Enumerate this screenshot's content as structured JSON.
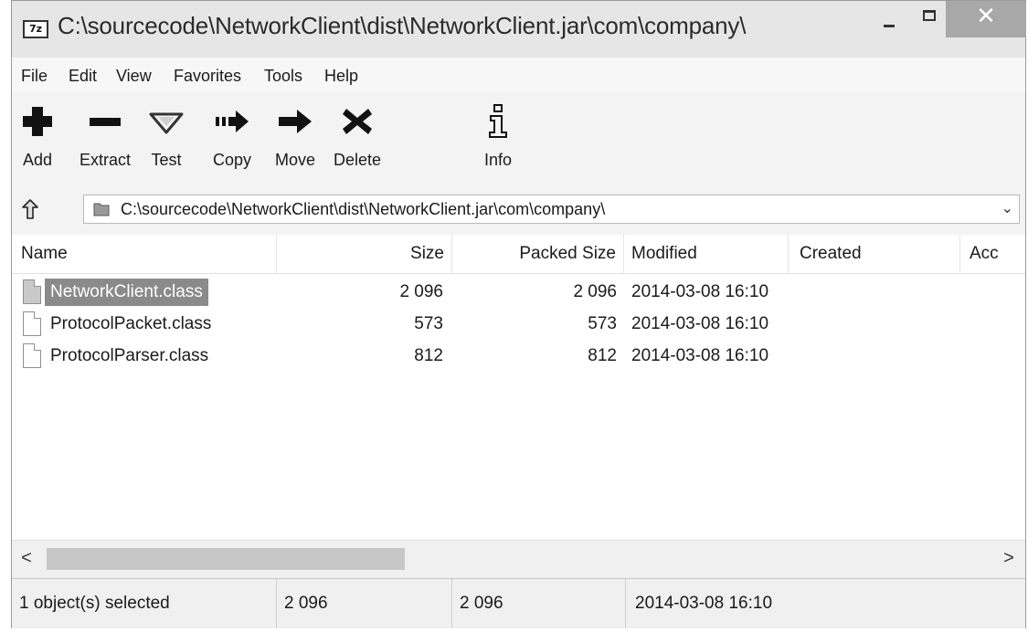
{
  "window": {
    "app_icon_text": "7z",
    "title": "C:\\sourcecode\\NetworkClient\\dist\\NetworkClient.jar\\com\\company\\",
    "close_glyph": "✕"
  },
  "menu": [
    "File",
    "Edit",
    "View",
    "Favorites",
    "Tools",
    "Help"
  ],
  "toolbar": [
    {
      "label": "Add",
      "icon": "add-icon"
    },
    {
      "label": "Extract",
      "icon": "extract-icon"
    },
    {
      "label": "Test",
      "icon": "test-icon"
    },
    {
      "label": "Copy",
      "icon": "copy-icon"
    },
    {
      "label": "Move",
      "icon": "move-icon"
    },
    {
      "label": "Delete",
      "icon": "delete-icon"
    },
    {
      "label": "Info",
      "icon": "info-icon"
    }
  ],
  "address": {
    "path": "C:\\sourcecode\\NetworkClient\\dist\\NetworkClient.jar\\com\\company\\",
    "dropdown_glyph": "⌄"
  },
  "columns": [
    "Name",
    "Size",
    "Packed Size",
    "Modified",
    "Created",
    "Acc"
  ],
  "files": [
    {
      "name": "NetworkClient.class",
      "size": "2 096",
      "packed": "2 096",
      "modified": "2014-03-08 16:10",
      "selected": true
    },
    {
      "name": "ProtocolPacket.class",
      "size": "573",
      "packed": "573",
      "modified": "2014-03-08 16:10",
      "selected": false
    },
    {
      "name": "ProtocolParser.class",
      "size": "812",
      "packed": "812",
      "modified": "2014-03-08 16:10",
      "selected": false
    }
  ],
  "scrollbar": {
    "left_glyph": "<",
    "right_glyph": ">"
  },
  "status": {
    "selection": "1 object(s) selected",
    "size": "2 096",
    "packed": "2 096",
    "modified": "2014-03-08 16:10"
  }
}
